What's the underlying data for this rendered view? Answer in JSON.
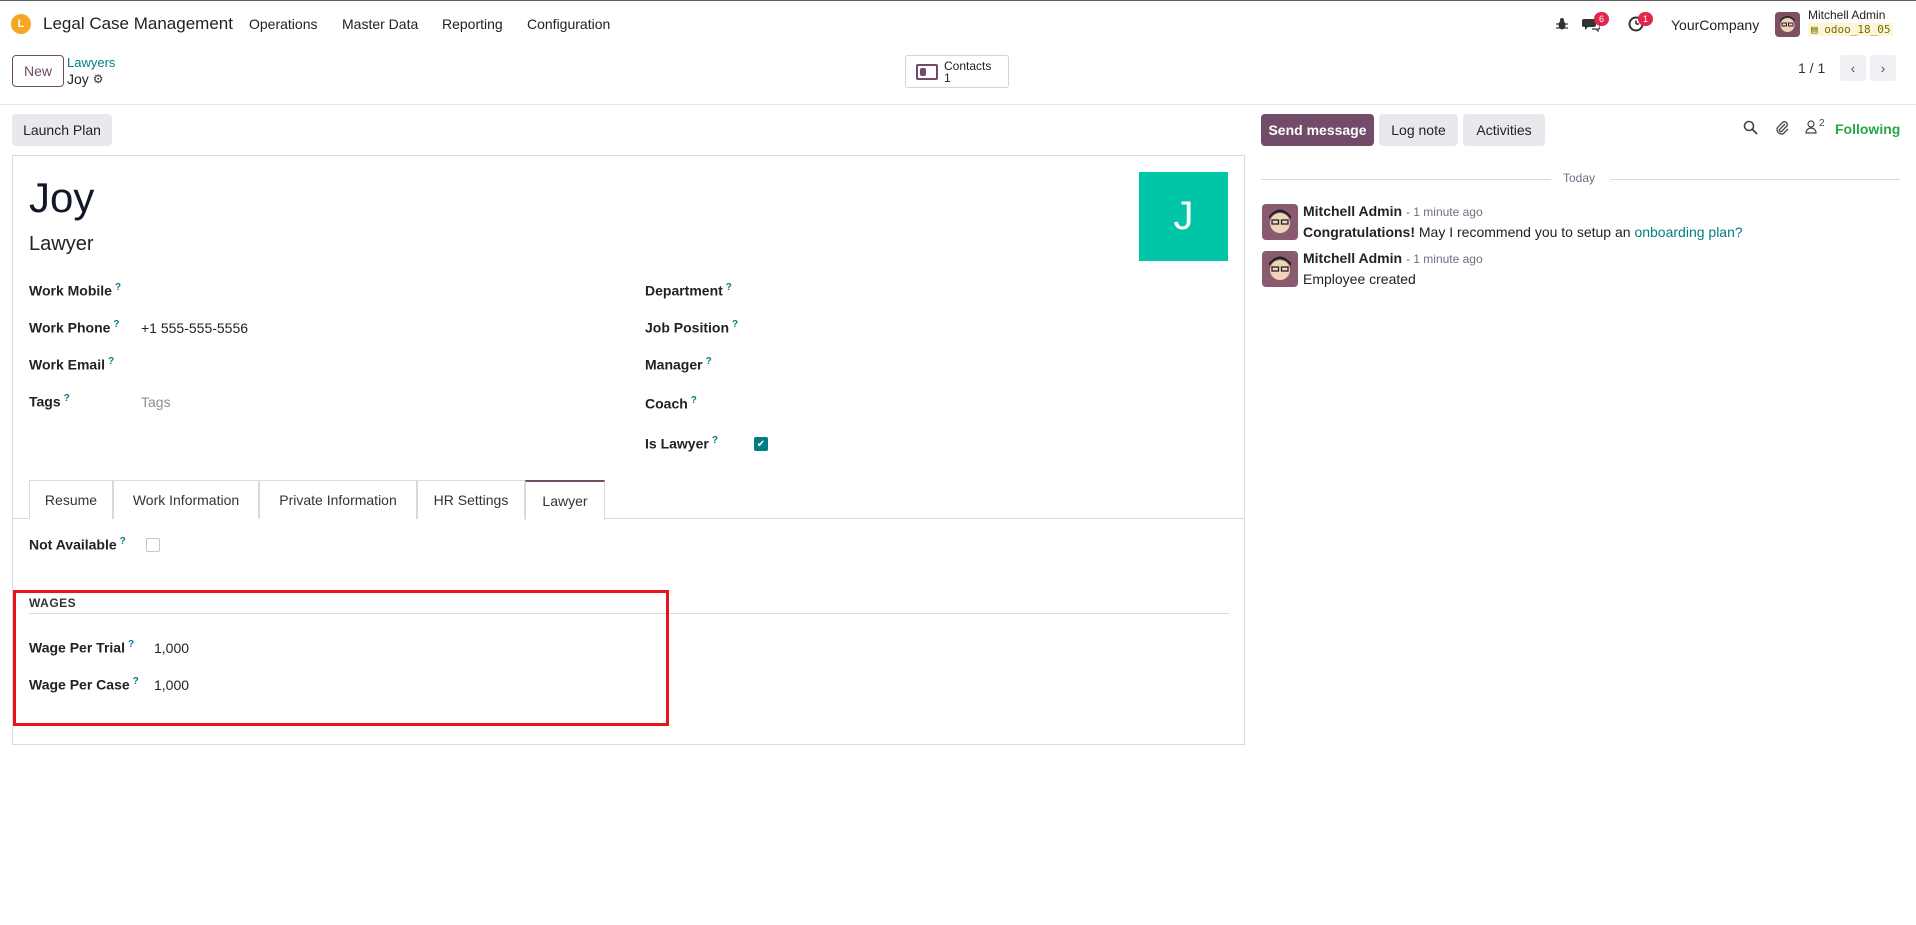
{
  "app": {
    "name": "Legal Case Management",
    "logo_letter": "L"
  },
  "menu": [
    "Operations",
    "Master Data",
    "Reporting",
    "Configuration"
  ],
  "systray": {
    "messages_count": "6",
    "activities_count": "1",
    "company": "YourCompany",
    "user_name": "Mitchell Admin",
    "db_name": "odoo_18_05"
  },
  "control_panel": {
    "new_label": "New",
    "breadcrumb_parent": "Lawyers",
    "breadcrumb_current": "Joy",
    "smart_button_label": "Contacts",
    "smart_button_count": "1",
    "pager": "1 / 1"
  },
  "status_bar": {
    "launch_plan": "Launch Plan"
  },
  "chatter_buttons": {
    "send_message": "Send message",
    "log_note": "Log note",
    "activities": "Activities",
    "followers_count": "2",
    "following": "Following"
  },
  "employee": {
    "name": "Joy",
    "job_title": "Lawyer",
    "avatar_letter": "J",
    "avatar_color": "#00c5a6"
  },
  "fields_left": [
    {
      "label": "Work Mobile",
      "value": ""
    },
    {
      "label": "Work Phone",
      "value": "+1 555-555-5556"
    },
    {
      "label": "Work Email",
      "value": ""
    },
    {
      "label": "Tags",
      "placeholder": "Tags"
    }
  ],
  "fields_right": [
    {
      "label": "Department",
      "value": ""
    },
    {
      "label": "Job Position",
      "value": ""
    },
    {
      "label": "Manager",
      "value": ""
    },
    {
      "label": "Coach",
      "value": ""
    },
    {
      "label": "Is Lawyer",
      "checked": true
    }
  ],
  "tabs": [
    "Resume",
    "Work Information",
    "Private Information",
    "HR Settings",
    "Lawyer"
  ],
  "active_tab": "Lawyer",
  "lawyer_tab": {
    "not_available_label": "Not Available",
    "not_available_checked": false,
    "section_title": "WAGES",
    "wage_per_trial_label": "Wage Per Trial",
    "wage_per_trial_value": "1,000",
    "wage_per_case_label": "Wage Per Case",
    "wage_per_case_value": "1,000"
  },
  "chatter": {
    "date_separator": "Today",
    "messages": [
      {
        "author": "Mitchell Admin",
        "time": "- 1 minute ago",
        "body_bold": "Congratulations!",
        "body_text": " May I recommend you to setup an ",
        "body_link": "onboarding plan?"
      },
      {
        "author": "Mitchell Admin",
        "time": "- 1 minute ago",
        "body_text": "Employee created"
      }
    ]
  },
  "colors": {
    "brand": "#714b67",
    "accent": "#017e84",
    "highlight": "#e8141b",
    "following": "#28a745"
  }
}
